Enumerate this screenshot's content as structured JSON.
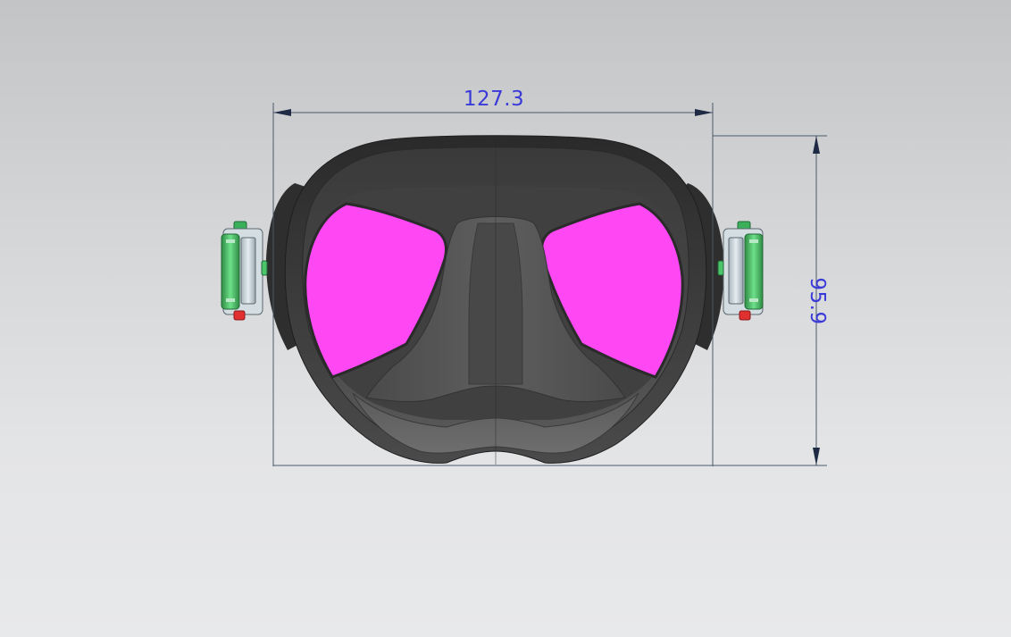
{
  "model": {
    "lens_color": "#ff48f4",
    "frame_color": "#3a3a3a",
    "buckle_color": "#4cc46a"
  },
  "dimensions": {
    "width_value": "127.3",
    "height_value": "95.9",
    "text_color": "#3a3ad8",
    "line_color": "#4a5a6a"
  }
}
